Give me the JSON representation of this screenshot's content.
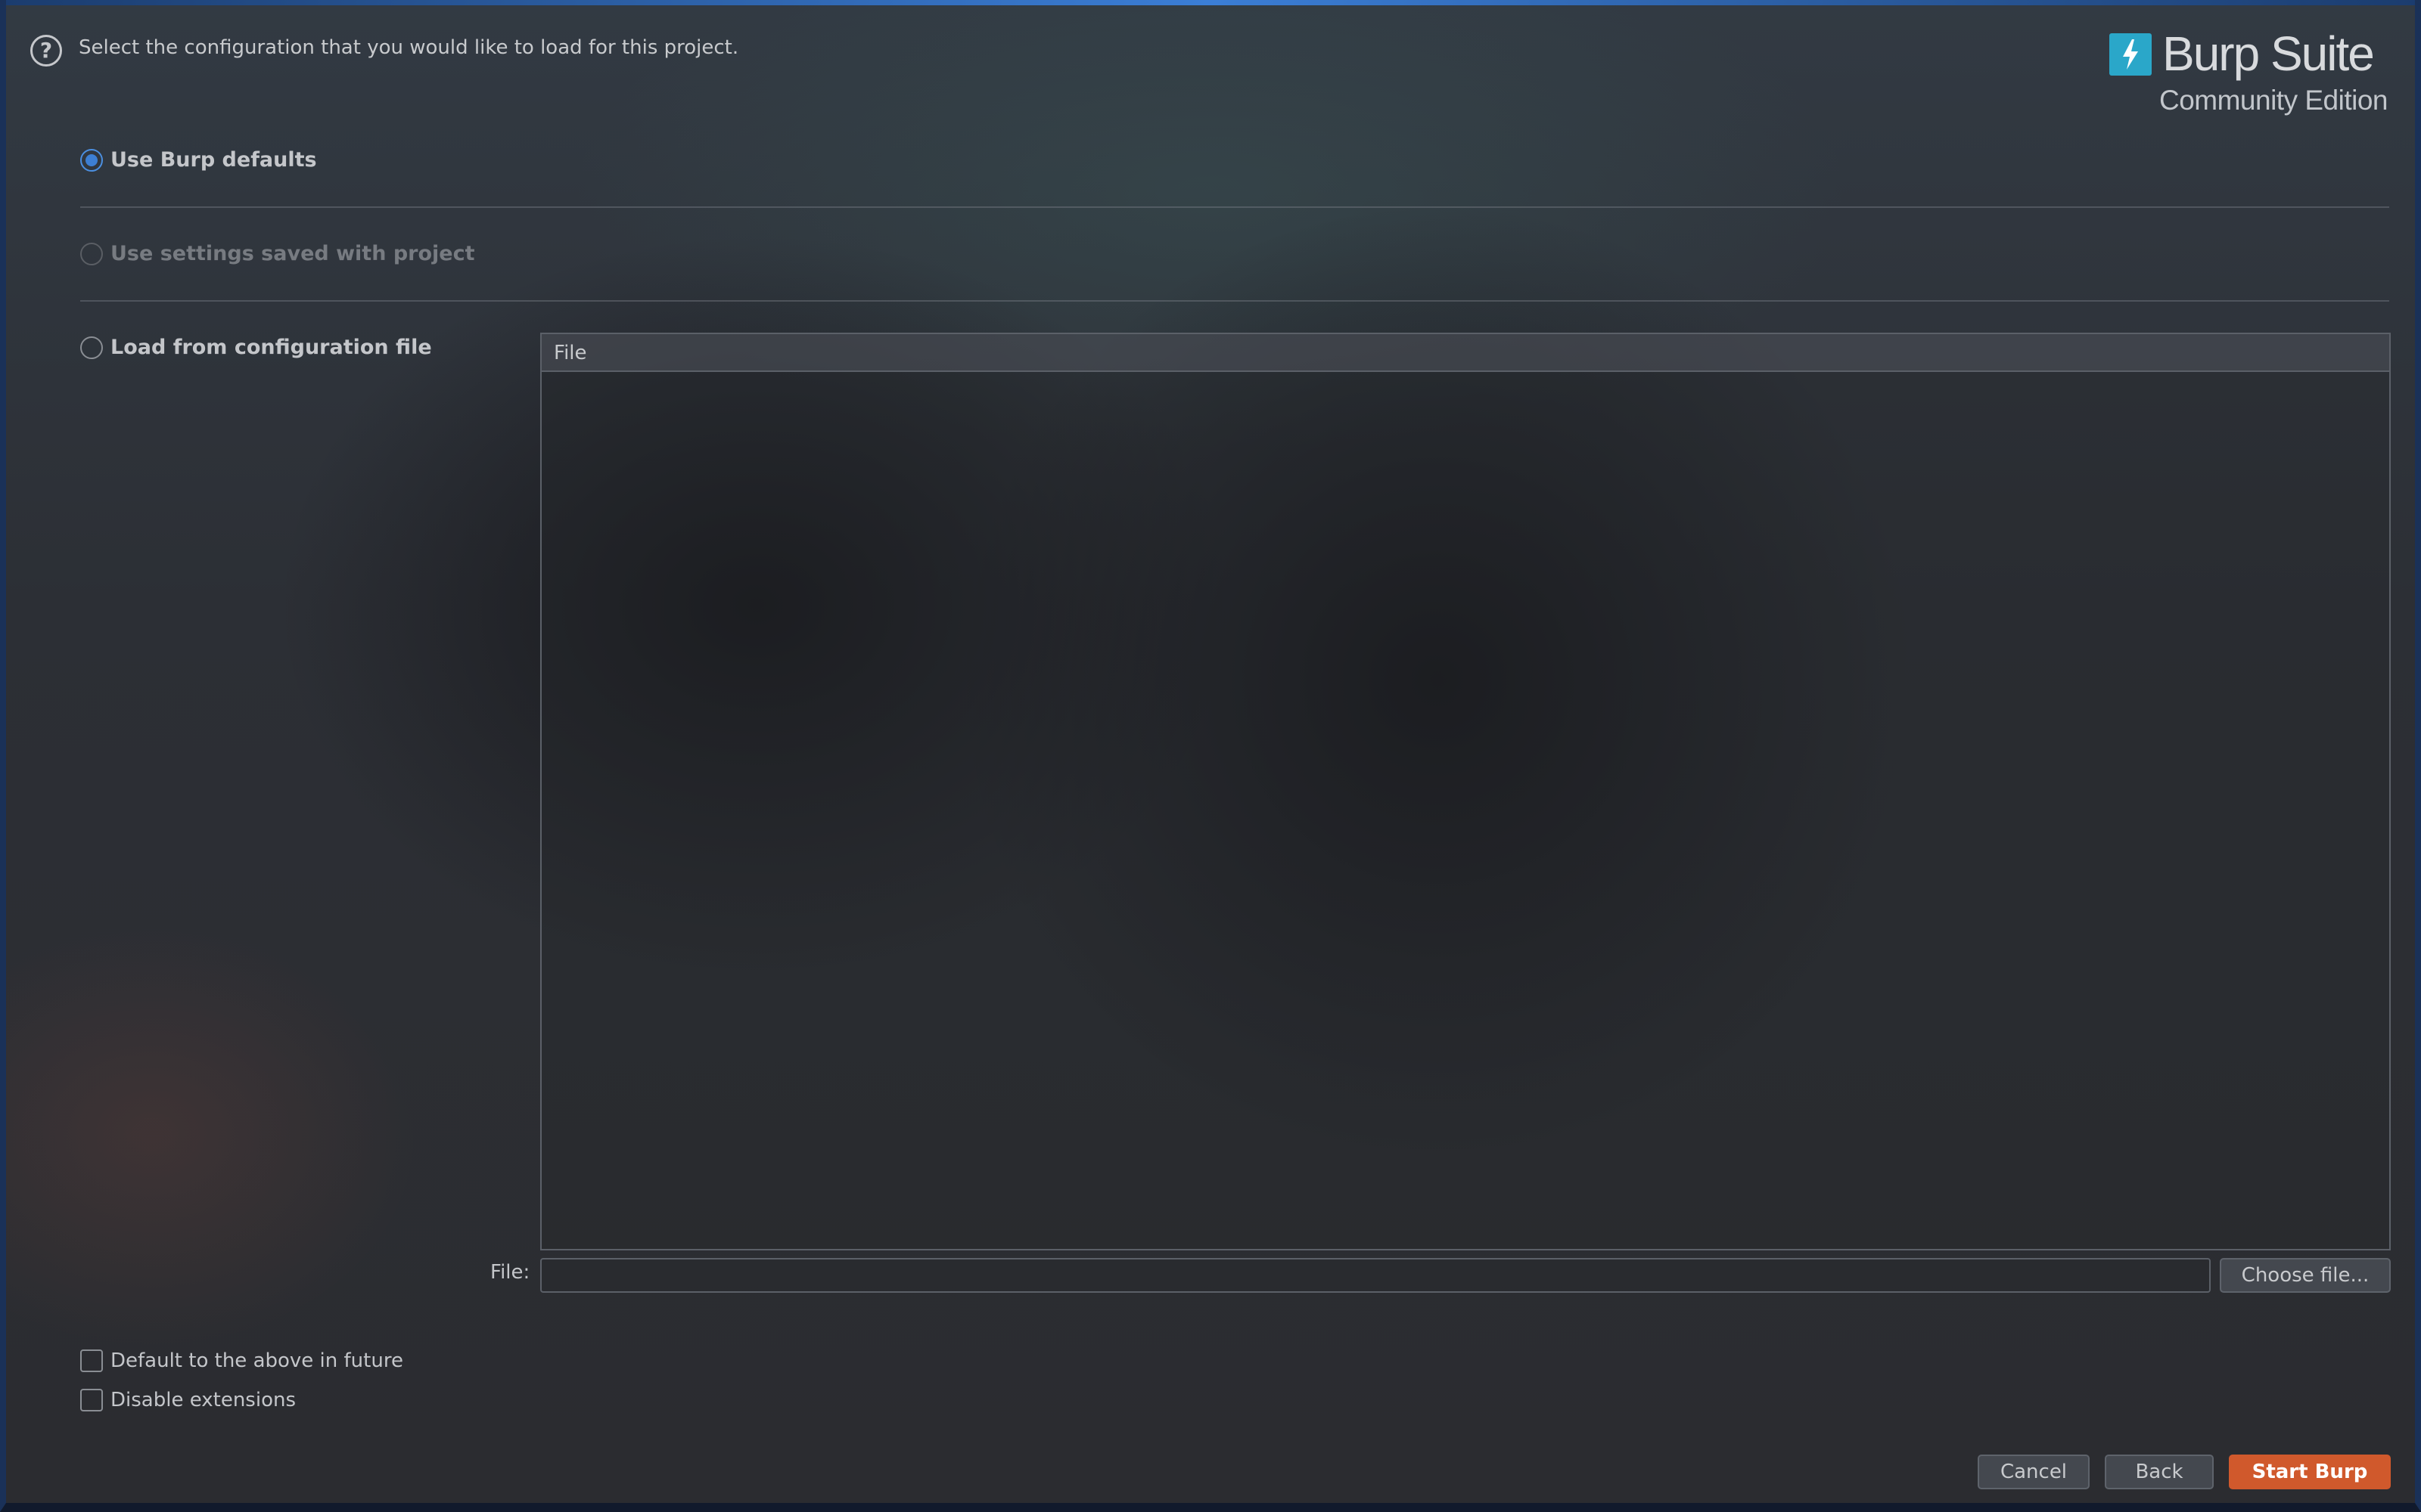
{
  "header": {
    "instruction": "Select the configuration that you would like to load for this project.",
    "help_icon": "question-mark-icon"
  },
  "logo": {
    "title": "Burp Suite",
    "subtitle": "Community Edition",
    "mark_icon": "lightning-bolt-icon",
    "mark_color": "#2aa7c9"
  },
  "options": [
    {
      "label": "Use Burp defaults",
      "selected": true,
      "enabled": true
    },
    {
      "label": "Use settings saved with project",
      "selected": false,
      "enabled": false
    },
    {
      "label": "Load from configuration file",
      "selected": false,
      "enabled": true
    }
  ],
  "file_table": {
    "columns": [
      "File"
    ],
    "rows": []
  },
  "file_field": {
    "label": "File:",
    "value": ""
  },
  "buttons": {
    "choose_file": "Choose file...",
    "cancel": "Cancel",
    "back": "Back",
    "start": "Start Burp"
  },
  "checkboxes": [
    {
      "label": "Default to the above in future",
      "checked": false
    },
    {
      "label": "Disable extensions",
      "checked": false
    }
  ],
  "colors": {
    "accent": "#3d7fd3",
    "start_button": "#d0592c"
  }
}
